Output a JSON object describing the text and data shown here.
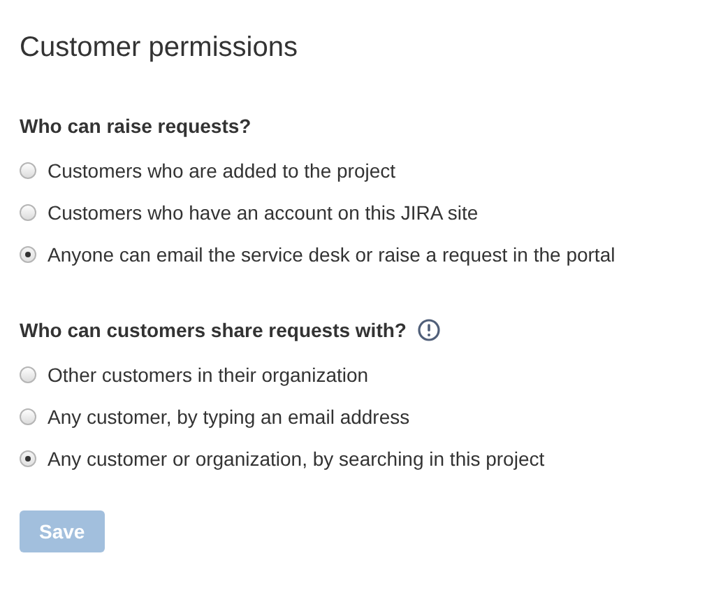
{
  "title": "Customer permissions",
  "sections": [
    {
      "heading": "Who can raise requests?",
      "info": false,
      "options": [
        {
          "label": "Customers who are added to the project",
          "selected": false
        },
        {
          "label": "Customers who have an account on this JIRA site",
          "selected": false
        },
        {
          "label": "Anyone can email the service desk or raise a request in the portal",
          "selected": true
        }
      ]
    },
    {
      "heading": "Who can customers share requests with?",
      "info": true,
      "options": [
        {
          "label": "Other customers in their organization",
          "selected": false
        },
        {
          "label": "Any customer, by typing an email address",
          "selected": false
        },
        {
          "label": "Any customer or organization, by searching in this project",
          "selected": true
        }
      ]
    }
  ],
  "save_button": {
    "label": "Save",
    "disabled": true
  }
}
